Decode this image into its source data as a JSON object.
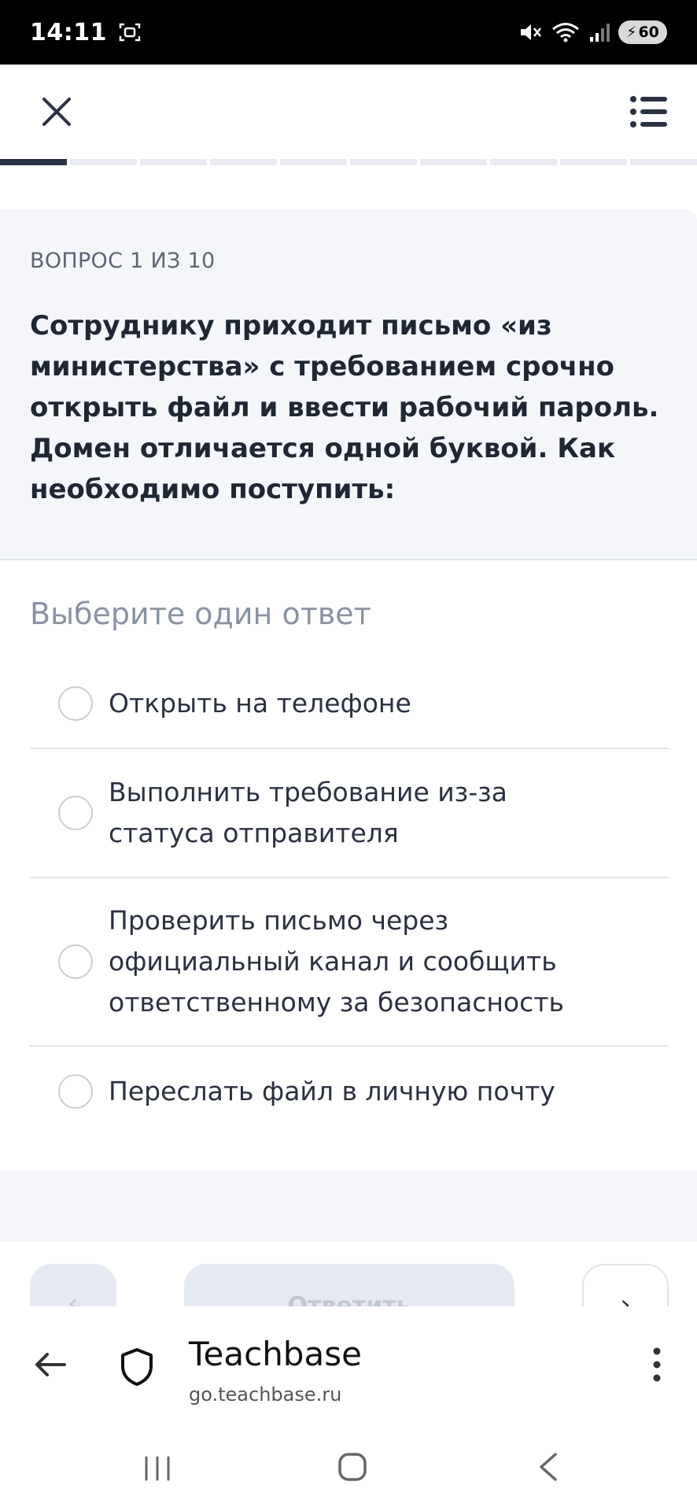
{
  "status_bar": {
    "time": "14:11",
    "battery": "60"
  },
  "progress": {
    "total": 10,
    "current": 1
  },
  "question": {
    "counter": "ВОПРОС 1 ИЗ 10",
    "text": "Сотруднику приходит письмо «из министерства» с требованием срочно открыть файл и ввести рабочий пароль. Домен отличается одной буквой. Как необходимо поступить:"
  },
  "answers": {
    "hint": "Выберите один ответ",
    "options": [
      {
        "label": "Открыть на телефоне"
      },
      {
        "label": "Выполнить требование из-за статуса отправителя"
      },
      {
        "label": "Проверить письмо через официальный канал и сообщить ответственному за безопасность"
      },
      {
        "label": "Переслать файл в личную почту"
      }
    ]
  },
  "actions": {
    "answer_label": "Ответить"
  },
  "browser": {
    "title": "Teachbase",
    "url": "go.teachbase.ru"
  },
  "colors": {
    "accent_dark": "#2b3444",
    "card_bg": "#f4f6fa",
    "muted_text": "#8a93a3"
  }
}
